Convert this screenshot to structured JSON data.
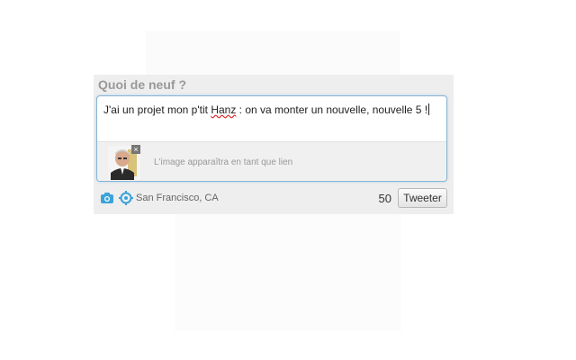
{
  "composer": {
    "heading": "Quoi de neuf ?",
    "text_before": "J'ai un projet mon p'tit ",
    "text_misspelled": "Hanz",
    "text_after": " : on va monter un nouvelle, nouvelle 5 !",
    "attachment_note": "L'image apparaîtra en tant que lien",
    "remove_label": "×"
  },
  "toolbar": {
    "camera_icon": "camera-icon",
    "geo_icon": "location-target-icon",
    "location": "San Francisco, CA",
    "char_count": "50",
    "submit_label": "Tweeter"
  },
  "colors": {
    "icon_blue": "#3aa3d9",
    "focus_border": "#86b4d6",
    "heading": "#999999"
  }
}
